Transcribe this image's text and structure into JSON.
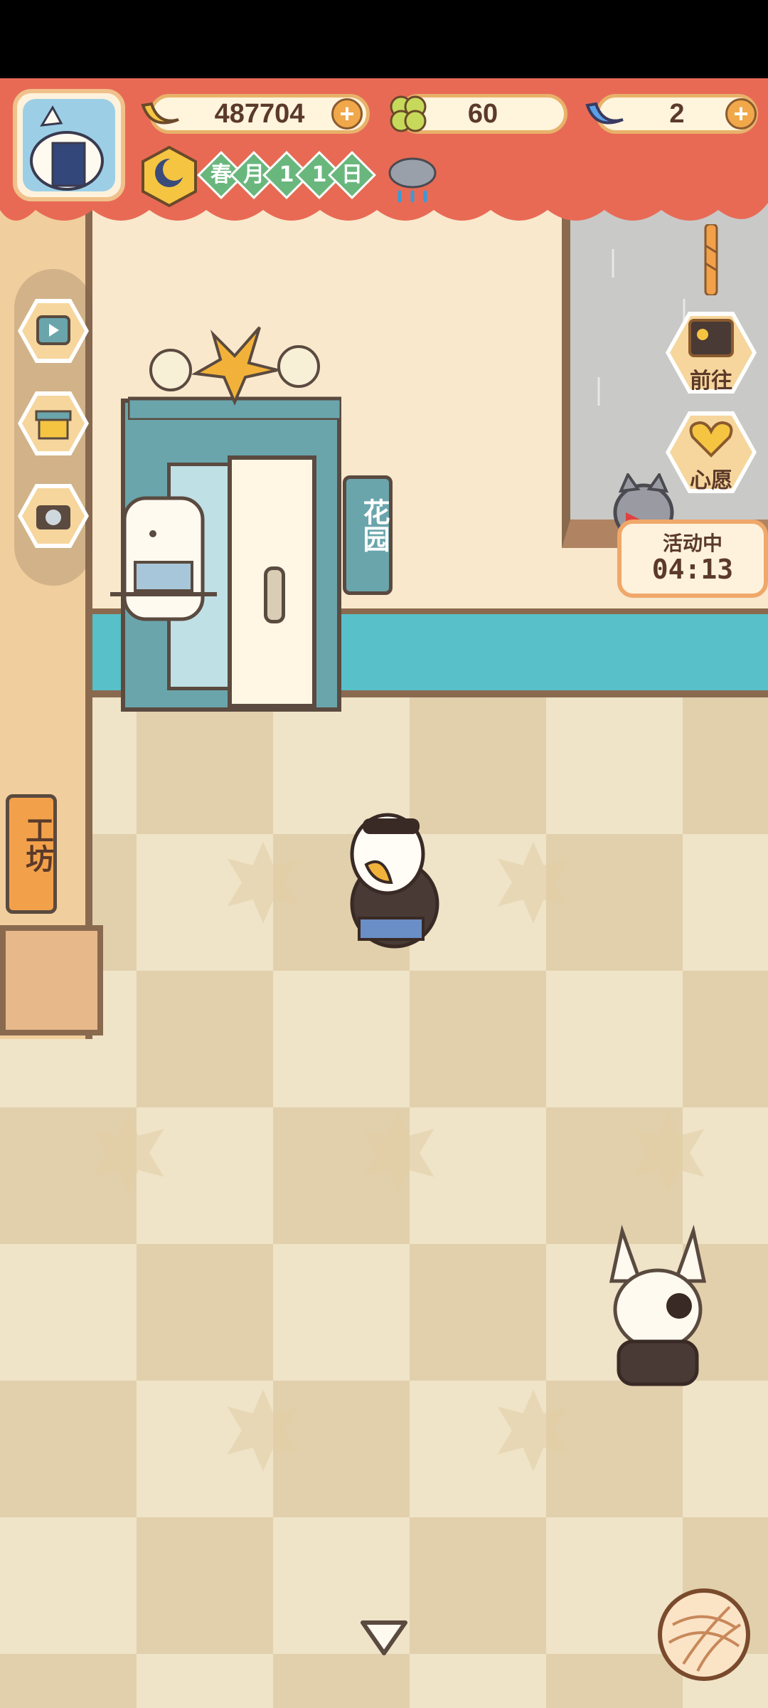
{
  "currencies": {
    "bananas": "487704",
    "clovers": "60",
    "gems": "2"
  },
  "date": {
    "season": "春",
    "month_label": "月",
    "month": "1",
    "day": "1",
    "day_label": "日"
  },
  "weather": {
    "icon": "rain-cloud-icon"
  },
  "side_menu": [
    {
      "icon": "video-tv-icon"
    },
    {
      "icon": "shop-icon"
    },
    {
      "icon": "camera-icon"
    }
  ],
  "right_menu": {
    "goto_label": "前往",
    "wish_label": "心愿"
  },
  "event": {
    "status": "活动中",
    "timer": "04:13"
  },
  "signs": {
    "garden": "花园",
    "workshop": "工坊"
  },
  "colors": {
    "hud_red": "#e86a55",
    "teal": "#57c0c9",
    "brown": "#8a6a4f",
    "wall": "#f9e8cc"
  }
}
